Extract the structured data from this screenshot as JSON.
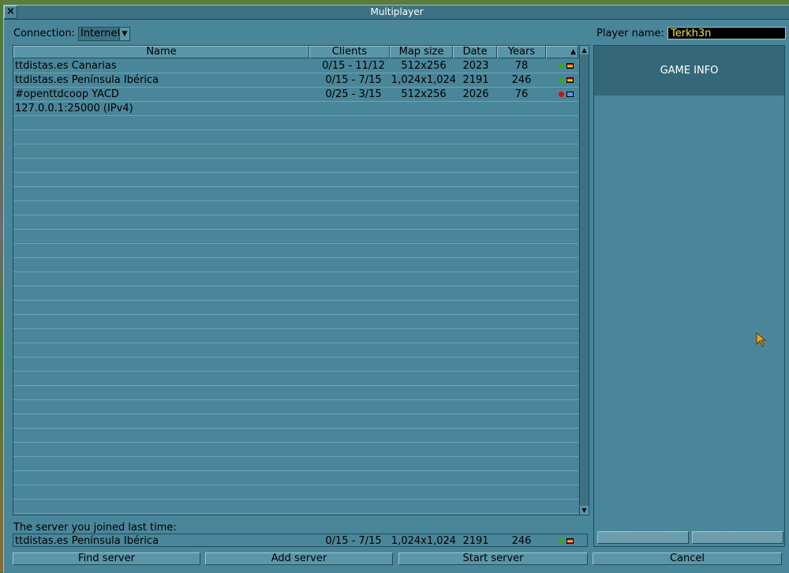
{
  "window": {
    "title": "Multiplayer",
    "close_glyph": "×"
  },
  "connection": {
    "label": "Connection:",
    "value": "Internet",
    "arrow": "▼"
  },
  "player": {
    "label": "Player name:",
    "value": "Terkh3n"
  },
  "list": {
    "columns": [
      "Name",
      "Clients",
      "Map size",
      "Date",
      "Years"
    ],
    "sort_indicator": "▲",
    "rows": [
      {
        "name": "ttdistas.es Canarias",
        "clients": "0/15 - 11/12",
        "size": "512x256",
        "date": "2023",
        "years": "78",
        "status_color": "#3aa820",
        "flag": "es"
      },
      {
        "name": "ttdistas.es Península Ibérica",
        "clients": "0/15 - 7/15",
        "size": "1,024x1,024",
        "date": "2191",
        "years": "246",
        "status_color": "#3aa820",
        "flag": "es"
      },
      {
        "name": "#openttdcoop YACD",
        "clients": "0/25 - 3/15",
        "size": "512x256",
        "date": "2026",
        "years": "76",
        "status_color": "#d01010",
        "flag": "un"
      },
      {
        "name": "127.0.0.1:25000 (IPv4)",
        "clients": "",
        "size": "",
        "date": "",
        "years": "",
        "status_color": "",
        "flag": ""
      }
    ],
    "scroll_up": "▲",
    "scroll_down": "▼"
  },
  "info": {
    "title": "GAME INFO",
    "join_label": "Join game",
    "refresh_label": "Refresh server"
  },
  "last_joined": {
    "label": "The server you joined last time:",
    "name": "ttdistas.es Península Ibérica",
    "clients": "0/15 - 7/15",
    "size": "1,024x1,024",
    "date": "2191",
    "years": "246",
    "status_color": "#3aa820"
  },
  "buttons": {
    "find": "Find server",
    "add": "Add server",
    "start": "Start server",
    "cancel": "Cancel"
  },
  "colors": {
    "window_bg": "#4a8699",
    "title_bg": "#3c7284",
    "input_text": "#f4e24a"
  }
}
